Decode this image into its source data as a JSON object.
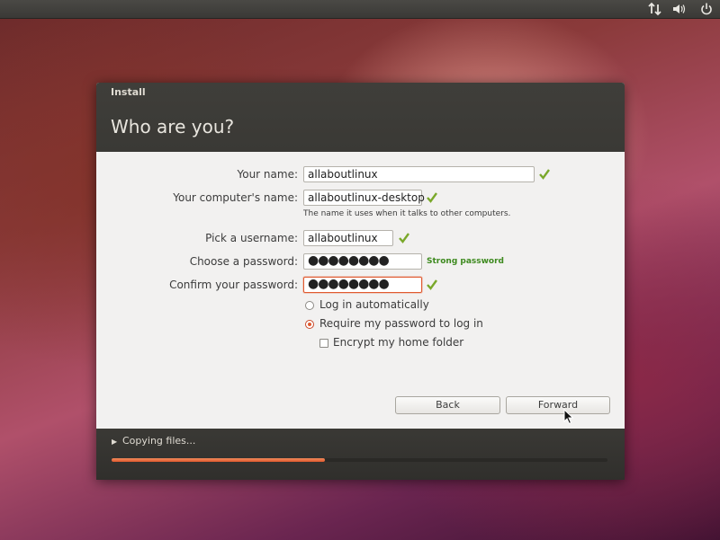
{
  "panel": {
    "icons": [
      "network-transfer-icon",
      "volume-icon",
      "power-icon"
    ]
  },
  "window": {
    "title": "Install",
    "heading": "Who are you?"
  },
  "form": {
    "name_label": "Your name:",
    "name_value": "allaboutlinux",
    "computer_label": "Your computer's name:",
    "computer_value": "allaboutlinux-desktop",
    "computer_hint": "The name it uses when it talks to other computers.",
    "username_label": "Pick a username:",
    "username_value": "allaboutlinux",
    "password_label": "Choose a password:",
    "password_value": "●●●●●●●●",
    "password_strength": "Strong password",
    "confirm_label": "Confirm your password:",
    "confirm_value": "●●●●●●●●",
    "login_auto_label": "Log in automatically",
    "login_auto_selected": false,
    "require_password_label": "Require my password to log in",
    "require_password_selected": true,
    "encrypt_label": "Encrypt my home folder",
    "encrypt_checked": false
  },
  "buttons": {
    "back": "Back",
    "forward": "Forward"
  },
  "status": {
    "expander_symbol": "▶",
    "text": "Copying files...",
    "progress": 0.43
  },
  "colors": {
    "accent": "#e05a2f",
    "check": "#7aa82a",
    "strong": "#3e8a1f",
    "header_bg": "#3c3b37"
  }
}
